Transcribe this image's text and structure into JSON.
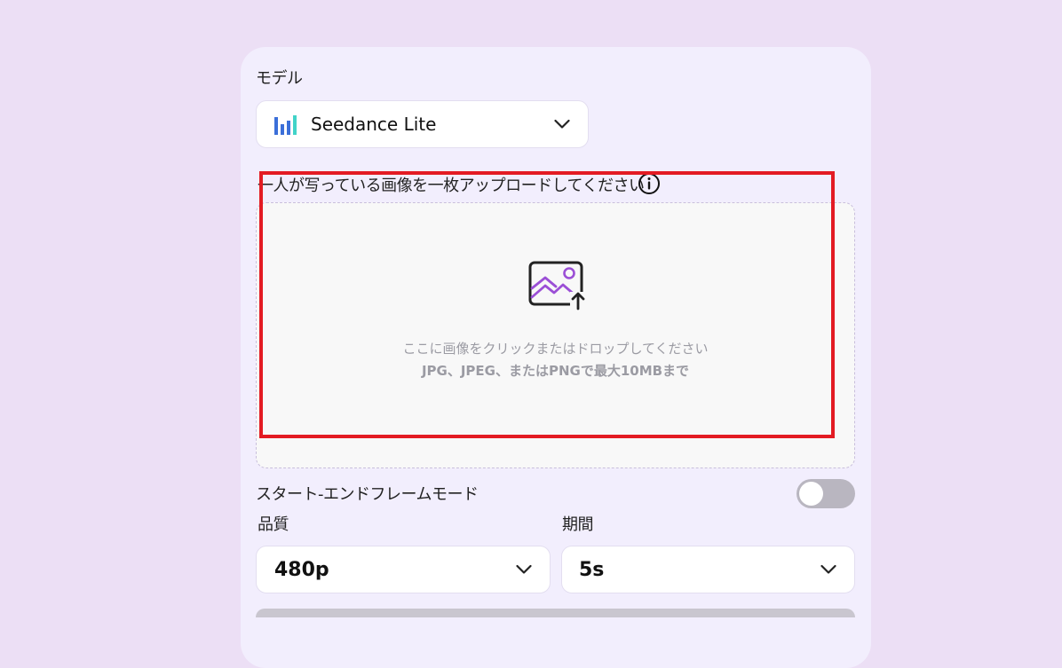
{
  "model": {
    "label": "モデル",
    "selected": "Seedance Lite"
  },
  "upload": {
    "label": "一人が写っている画像を一枚アップロードしてください",
    "line1": "ここに画像をクリックまたはドロップしてください",
    "line2": "JPG、JPEG、またはPNGで最大10MBまで"
  },
  "start_end_mode": {
    "label": "スタート-エンドフレームモード",
    "enabled": false
  },
  "quality": {
    "label": "品質",
    "selected": "480p"
  },
  "duration": {
    "label": "期間",
    "selected": "5s"
  },
  "colors": {
    "background": "#ecdff5",
    "panel": "#f2eefd",
    "highlight": "#e31b23",
    "accent": "#9b4fd6"
  },
  "icons": {
    "model": "bar-chart-logo-icon",
    "info": "info-icon",
    "upload": "image-upload-icon",
    "chevron": "chevron-down-icon"
  }
}
